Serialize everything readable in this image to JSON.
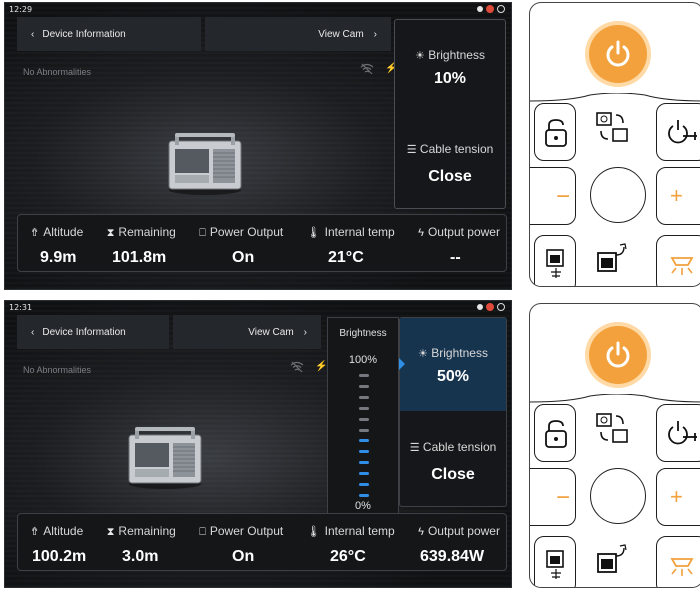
{
  "screens": [
    {
      "time": "12:29",
      "device_info_label": "Device Information",
      "view_cam_label": "View Cam",
      "abnormality": "No Abnormalities",
      "brightness_label": "Brightness",
      "brightness_value": "10%",
      "cable_label": "Cable tension",
      "cable_value": "Close",
      "stats_labels": [
        "Altitude",
        "Remaining",
        "Power Output",
        "Internal temp",
        "Output power"
      ],
      "stats_values": [
        "9.9m",
        "101.8m",
        "On",
        "21°C",
        "--"
      ]
    },
    {
      "time": "12:31",
      "device_info_label": "Device Information",
      "view_cam_label": "View Cam",
      "abnormality": "No Abnormalities",
      "slider_title": "Brightness",
      "slider_max": "100%",
      "slider_min": "0%",
      "slider_level": 0.5,
      "brightness_label": "Brightness",
      "brightness_value": "50%",
      "cable_label": "Cable tension",
      "cable_value": "Close",
      "stats_labels": [
        "Altitude",
        "Remaining",
        "Power Output",
        "Internal temp",
        "Output power"
      ],
      "stats_values": [
        "100.2m",
        "3.0m",
        "On",
        "26°C",
        "639.84W"
      ]
    }
  ],
  "colors": {
    "accent_orange": "#f2a13c",
    "accent_blue": "#2f8fe6",
    "active_panel": "#17344f"
  },
  "icons": [
    "back-chevron-icon",
    "forward-chevron-icon",
    "wifi-off-icon",
    "bolt-icon",
    "brightness-icon",
    "cable-icon",
    "altitude-icon",
    "remaining-icon",
    "power-output-icon",
    "thermometer-icon",
    "output-power-icon",
    "power-icon",
    "unlock-icon",
    "rotate-icon",
    "hook-power-icon",
    "light-icon"
  ]
}
